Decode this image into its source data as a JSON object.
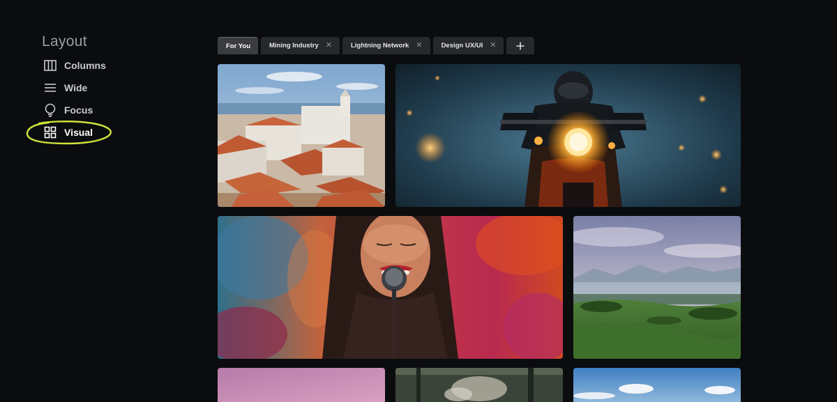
{
  "sidebar": {
    "title": "Layout",
    "items": [
      {
        "label": "Columns",
        "icon": "columns-icon"
      },
      {
        "label": "Wide",
        "icon": "wide-icon"
      },
      {
        "label": "Focus",
        "icon": "focus-icon"
      },
      {
        "label": "Visual",
        "icon": "visual-grid-icon",
        "active": true
      }
    ],
    "highlight_color": "#cfe23a"
  },
  "tabs": [
    {
      "label": "For You",
      "active": true,
      "closable": false
    },
    {
      "label": "Mining Industry",
      "closable": true
    },
    {
      "label": "Lightning Network",
      "closable": true
    },
    {
      "label": "Design UX/UI",
      "closable": true
    }
  ],
  "add_tab_label": "+",
  "close_glyph": "✕",
  "gallery": {
    "cards": [
      {
        "subject": "coastal-town"
      },
      {
        "subject": "motorcycle-rider"
      },
      {
        "subject": "singer-portrait"
      },
      {
        "subject": "green-hills-landscape"
      },
      {
        "subject": "pink-sky"
      },
      {
        "subject": "industrial-scene"
      },
      {
        "subject": "blue-sky-clouds"
      }
    ]
  }
}
